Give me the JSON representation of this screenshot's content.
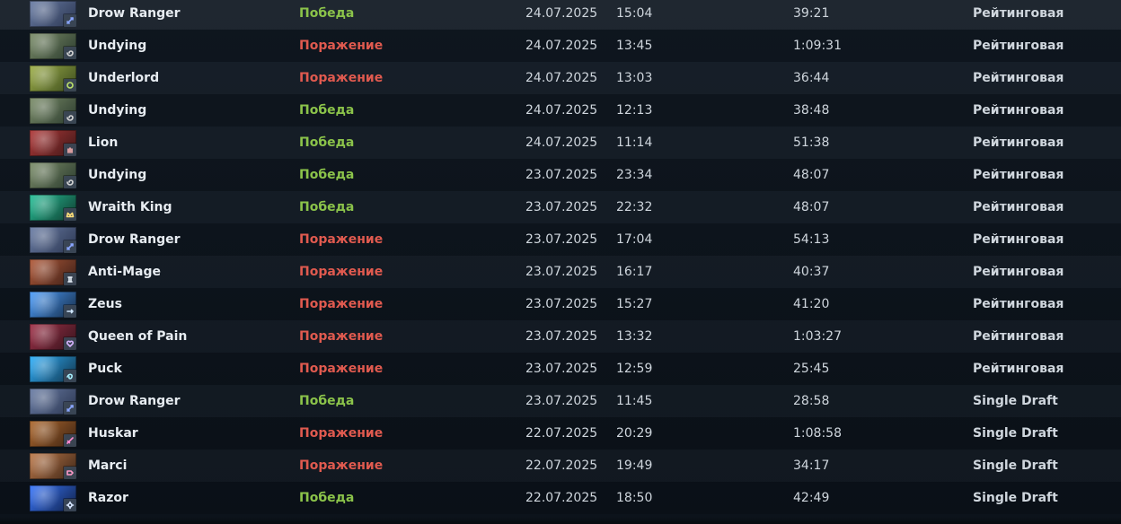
{
  "matches": [
    {
      "hero": "Drow Ranger",
      "result": "Победа",
      "outcome": "win",
      "date": "24.07.2025",
      "time": "15:04",
      "duration": "39:21",
      "mode": "Рейтинговая",
      "portrait_color_a": "#6b7ea6",
      "portrait_color_b": "#2a3550",
      "role_icon": "bow-icon",
      "role_color": "#8aa6ff"
    },
    {
      "hero": "Undying",
      "result": "Поражение",
      "outcome": "loss",
      "date": "24.07.2025",
      "time": "13:45",
      "duration": "1:09:31",
      "mode": "Рейтинговая",
      "portrait_color_a": "#7c8e6a",
      "portrait_color_b": "#2a3a2d",
      "role_icon": "spiral-icon",
      "role_color": "#d7d7d7"
    },
    {
      "hero": "Underlord",
      "result": "Поражение",
      "outcome": "loss",
      "date": "24.07.2025",
      "time": "13:03",
      "duration": "36:44",
      "mode": "Рейтинговая",
      "portrait_color_a": "#9fb04a",
      "portrait_color_b": "#3a4a1d",
      "role_icon": "circle-icon",
      "role_color": "#bde36a"
    },
    {
      "hero": "Undying",
      "result": "Победа",
      "outcome": "win",
      "date": "24.07.2025",
      "time": "12:13",
      "duration": "38:48",
      "mode": "Рейтинговая",
      "portrait_color_a": "#7c8e6a",
      "portrait_color_b": "#2a3a2d",
      "role_icon": "spiral-icon",
      "role_color": "#d7d7d7"
    },
    {
      "hero": "Lion",
      "result": "Победа",
      "outcome": "win",
      "date": "24.07.2025",
      "time": "11:14",
      "duration": "51:38",
      "mode": "Рейтинговая",
      "portrait_color_a": "#b23a3a",
      "portrait_color_b": "#3d1717",
      "role_icon": "hand-icon",
      "role_color": "#ffb3b3"
    },
    {
      "hero": "Undying",
      "result": "Победа",
      "outcome": "win",
      "date": "23.07.2025",
      "time": "23:34",
      "duration": "48:07",
      "mode": "Рейтинговая",
      "portrait_color_a": "#7c8e6a",
      "portrait_color_b": "#2a3a2d",
      "role_icon": "spiral-icon",
      "role_color": "#d7d7d7"
    },
    {
      "hero": "Wraith King",
      "result": "Победа",
      "outcome": "win",
      "date": "23.07.2025",
      "time": "22:32",
      "duration": "48:07",
      "mode": "Рейтинговая",
      "portrait_color_a": "#27c39a",
      "portrait_color_b": "#0f3a2d",
      "role_icon": "crown-icon",
      "role_color": "#ffe07a"
    },
    {
      "hero": "Drow Ranger",
      "result": "Поражение",
      "outcome": "loss",
      "date": "23.07.2025",
      "time": "17:04",
      "duration": "54:13",
      "mode": "Рейтинговая",
      "portrait_color_a": "#6b7ea6",
      "portrait_color_b": "#2a3550",
      "role_icon": "bow-icon",
      "role_color": "#8aa6ff"
    },
    {
      "hero": "Anti-Mage",
      "result": "Поражение",
      "outcome": "loss",
      "date": "23.07.2025",
      "time": "16:17",
      "duration": "40:37",
      "mode": "Рейтинговая",
      "portrait_color_a": "#b35b3a",
      "portrait_color_b": "#3a1e17",
      "role_icon": "tower-icon",
      "role_color": "#e6eef7"
    },
    {
      "hero": "Zeus",
      "result": "Поражение",
      "outcome": "loss",
      "date": "23.07.2025",
      "time": "15:27",
      "duration": "41:20",
      "mode": "Рейтинговая",
      "portrait_color_a": "#4ea0ff",
      "portrait_color_b": "#142a45",
      "role_icon": "bolt-icon",
      "role_color": "#cfe6ff"
    },
    {
      "hero": "Queen of Pain",
      "result": "Поражение",
      "outcome": "loss",
      "date": "23.07.2025",
      "time": "13:32",
      "duration": "1:03:27",
      "mode": "Рейтинговая",
      "portrait_color_a": "#a3324a",
      "portrait_color_b": "#32131b",
      "role_icon": "heart-icon",
      "role_color": "#d7b3ff"
    },
    {
      "hero": "Puck",
      "result": "Поражение",
      "outcome": "loss",
      "date": "23.07.2025",
      "time": "12:59",
      "duration": "25:45",
      "mode": "Рейтинговая",
      "portrait_color_a": "#2fb2ff",
      "portrait_color_b": "#113248",
      "role_icon": "swirl-icon",
      "role_color": "#a6f1ff"
    },
    {
      "hero": "Drow Ranger",
      "result": "Победа",
      "outcome": "win",
      "date": "23.07.2025",
      "time": "11:45",
      "duration": "28:58",
      "mode": "Single Draft",
      "portrait_color_a": "#6b7ea6",
      "portrait_color_b": "#2a3550",
      "role_icon": "bow-icon",
      "role_color": "#8aa6ff"
    },
    {
      "hero": "Huskar",
      "result": "Поражение",
      "outcome": "loss",
      "date": "22.07.2025",
      "time": "20:29",
      "duration": "1:08:58",
      "mode": "Single Draft",
      "portrait_color_a": "#b06a2f",
      "portrait_color_b": "#3b2212",
      "role_icon": "spear-icon",
      "role_color": "#ff8ad0"
    },
    {
      "hero": "Marci",
      "result": "Поражение",
      "outcome": "loss",
      "date": "22.07.2025",
      "time": "19:49",
      "duration": "34:17",
      "mode": "Single Draft",
      "portrait_color_a": "#c07b4b",
      "portrait_color_b": "#3b2416",
      "role_icon": "fist-icon",
      "role_color": "#ff9ac9"
    },
    {
      "hero": "Razor",
      "result": "Победа",
      "outcome": "win",
      "date": "22.07.2025",
      "time": "18:50",
      "duration": "42:49",
      "mode": "Single Draft",
      "portrait_color_a": "#3a78ff",
      "portrait_color_b": "#0f1f45",
      "role_icon": "gear-icon",
      "role_color": "#d7e6ff"
    }
  ]
}
